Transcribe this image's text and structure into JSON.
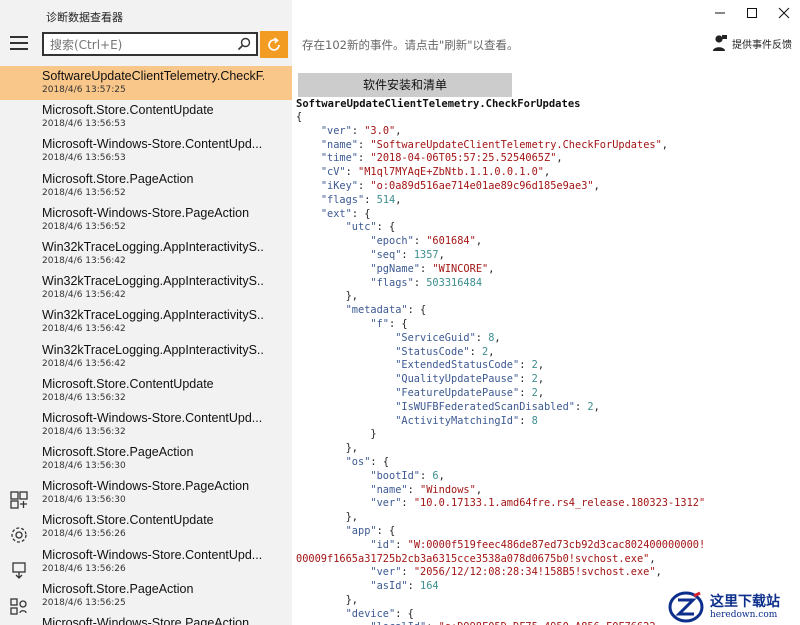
{
  "app": {
    "title": "诊断数据查看器"
  },
  "search": {
    "placeholder": "搜索(Ctrl+E)",
    "value": ""
  },
  "status": {
    "text": "存在102新的事件。请点击\"刷新\"以查看。"
  },
  "feedback": {
    "label": "提供事件反馈"
  },
  "category_tab": {
    "label": "软件安装和清单"
  },
  "selected_event": {
    "name": "SoftwareUpdateClientTelemetry.CheckForUpdates"
  },
  "events": [
    {
      "name": "SoftwareUpdateClientTelemetry.CheckF...",
      "time": "2018/4/6 13:57:25",
      "selected": true
    },
    {
      "name": "Microsoft.Store.ContentUpdate",
      "time": "2018/4/6 13:56:53"
    },
    {
      "name": "Microsoft-Windows-Store.ContentUpd...",
      "time": "2018/4/6 13:56:53"
    },
    {
      "name": "Microsoft.Store.PageAction",
      "time": "2018/4/6 13:56:52"
    },
    {
      "name": "Microsoft-Windows-Store.PageAction",
      "time": "2018/4/6 13:56:52"
    },
    {
      "name": "Win32kTraceLogging.AppInteractivityS...",
      "time": "2018/4/6 13:56:42"
    },
    {
      "name": "Win32kTraceLogging.AppInteractivityS...",
      "time": "2018/4/6 13:56:42"
    },
    {
      "name": "Win32kTraceLogging.AppInteractivityS...",
      "time": "2018/4/6 13:56:42"
    },
    {
      "name": "Win32kTraceLogging.AppInteractivityS...",
      "time": "2018/4/6 13:56:42"
    },
    {
      "name": "Microsoft.Store.ContentUpdate",
      "time": "2018/4/6 13:56:32"
    },
    {
      "name": "Microsoft-Windows-Store.ContentUpd...",
      "time": "2018/4/6 13:56:32"
    },
    {
      "name": "Microsoft.Store.PageAction",
      "time": "2018/4/6 13:56:30"
    },
    {
      "name": "Microsoft-Windows-Store.PageAction",
      "time": "2018/4/6 13:56:30"
    },
    {
      "name": "Microsoft.Store.ContentUpdate",
      "time": "2018/4/6 13:56:26"
    },
    {
      "name": "Microsoft-Windows-Store.ContentUpd...",
      "time": "2018/4/6 13:56:26"
    },
    {
      "name": "Microsoft.Store.PageAction",
      "time": "2018/4/6 13:56:25"
    },
    {
      "name": "Microsoft-Windows-Store.PageAction",
      "time": ""
    }
  ],
  "json_lines": [
    [
      [
        0,
        "p",
        "{"
      ]
    ],
    [
      [
        1,
        "k",
        "\"ver\""
      ],
      [
        0,
        "p",
        ": "
      ],
      [
        0,
        "s",
        "\"3.0\""
      ],
      [
        0,
        "p",
        ","
      ]
    ],
    [
      [
        1,
        "k",
        "\"name\""
      ],
      [
        0,
        "p",
        ": "
      ],
      [
        0,
        "s",
        "\"SoftwareUpdateClientTelemetry.CheckForUpdates\""
      ],
      [
        0,
        "p",
        ","
      ]
    ],
    [
      [
        1,
        "k",
        "\"time\""
      ],
      [
        0,
        "p",
        ": "
      ],
      [
        0,
        "s",
        "\"2018-04-06T05:57:25.5254065Z\""
      ],
      [
        0,
        "p",
        ","
      ]
    ],
    [
      [
        1,
        "k",
        "\"cV\""
      ],
      [
        0,
        "p",
        ": "
      ],
      [
        0,
        "s",
        "\"M1ql7MYAqE+ZbNtb.1.1.0.0.1.0\""
      ],
      [
        0,
        "p",
        ","
      ]
    ],
    [
      [
        1,
        "k",
        "\"iKey\""
      ],
      [
        0,
        "p",
        ": "
      ],
      [
        0,
        "s",
        "\"o:0a89d516ae714e01ae89c96d185e9ae3\""
      ],
      [
        0,
        "p",
        ","
      ]
    ],
    [
      [
        1,
        "k",
        "\"flags\""
      ],
      [
        0,
        "p",
        ": "
      ],
      [
        0,
        "n",
        "514"
      ],
      [
        0,
        "p",
        ","
      ]
    ],
    [
      [
        1,
        "k",
        "\"ext\""
      ],
      [
        0,
        "p",
        ": {"
      ]
    ],
    [
      [
        2,
        "k",
        "\"utc\""
      ],
      [
        0,
        "p",
        ": {"
      ]
    ],
    [
      [
        3,
        "k",
        "\"epoch\""
      ],
      [
        0,
        "p",
        ": "
      ],
      [
        0,
        "s",
        "\"601684\""
      ],
      [
        0,
        "p",
        ","
      ]
    ],
    [
      [
        3,
        "k",
        "\"seq\""
      ],
      [
        0,
        "p",
        ": "
      ],
      [
        0,
        "n",
        "1357"
      ],
      [
        0,
        "p",
        ","
      ]
    ],
    [
      [
        3,
        "k",
        "\"pgName\""
      ],
      [
        0,
        "p",
        ": "
      ],
      [
        0,
        "s",
        "\"WINCORE\""
      ],
      [
        0,
        "p",
        ","
      ]
    ],
    [
      [
        3,
        "k",
        "\"flags\""
      ],
      [
        0,
        "p",
        ": "
      ],
      [
        0,
        "n",
        "503316484"
      ]
    ],
    [
      [
        2,
        "p",
        "},"
      ]
    ],
    [
      [
        2,
        "k",
        "\"metadata\""
      ],
      [
        0,
        "p",
        ": {"
      ]
    ],
    [
      [
        3,
        "k",
        "\"f\""
      ],
      [
        0,
        "p",
        ": {"
      ]
    ],
    [
      [
        4,
        "k",
        "\"ServiceGuid\""
      ],
      [
        0,
        "p",
        ": "
      ],
      [
        0,
        "n",
        "8"
      ],
      [
        0,
        "p",
        ","
      ]
    ],
    [
      [
        4,
        "k",
        "\"StatusCode\""
      ],
      [
        0,
        "p",
        ": "
      ],
      [
        0,
        "n",
        "2"
      ],
      [
        0,
        "p",
        ","
      ]
    ],
    [
      [
        4,
        "k",
        "\"ExtendedStatusCode\""
      ],
      [
        0,
        "p",
        ": "
      ],
      [
        0,
        "n",
        "2"
      ],
      [
        0,
        "p",
        ","
      ]
    ],
    [
      [
        4,
        "k",
        "\"QualityUpdatePause\""
      ],
      [
        0,
        "p",
        ": "
      ],
      [
        0,
        "n",
        "2"
      ],
      [
        0,
        "p",
        ","
      ]
    ],
    [
      [
        4,
        "k",
        "\"FeatureUpdatePause\""
      ],
      [
        0,
        "p",
        ": "
      ],
      [
        0,
        "n",
        "2"
      ],
      [
        0,
        "p",
        ","
      ]
    ],
    [
      [
        4,
        "k",
        "\"IsWUFBFederatedScanDisabled\""
      ],
      [
        0,
        "p",
        ": "
      ],
      [
        0,
        "n",
        "2"
      ],
      [
        0,
        "p",
        ","
      ]
    ],
    [
      [
        4,
        "k",
        "\"ActivityMatchingId\""
      ],
      [
        0,
        "p",
        ": "
      ],
      [
        0,
        "n",
        "8"
      ]
    ],
    [
      [
        3,
        "p",
        "}"
      ]
    ],
    [
      [
        2,
        "p",
        "},"
      ]
    ],
    [
      [
        2,
        "k",
        "\"os\""
      ],
      [
        0,
        "p",
        ": {"
      ]
    ],
    [
      [
        3,
        "k",
        "\"bootId\""
      ],
      [
        0,
        "p",
        ": "
      ],
      [
        0,
        "n",
        "6"
      ],
      [
        0,
        "p",
        ","
      ]
    ],
    [
      [
        3,
        "k",
        "\"name\""
      ],
      [
        0,
        "p",
        ": "
      ],
      [
        0,
        "s",
        "\"Windows\""
      ],
      [
        0,
        "p",
        ","
      ]
    ],
    [
      [
        3,
        "k",
        "\"ver\""
      ],
      [
        0,
        "p",
        ": "
      ],
      [
        0,
        "s",
        "\"10.0.17133.1.amd64fre.rs4_release.180323-1312\""
      ]
    ],
    [
      [
        2,
        "p",
        "},"
      ]
    ],
    [
      [
        2,
        "k",
        "\"app\""
      ],
      [
        0,
        "p",
        ": {"
      ]
    ],
    [
      [
        3,
        "k",
        "\"id\""
      ],
      [
        0,
        "p",
        ": "
      ],
      [
        0,
        "s",
        "\"W:0000f519feec486de87ed73cb92d3cac802400000000!"
      ]
    ],
    [
      [
        0,
        "s",
        "00009f1665a31725b2cb3a6315cce3538a078d0675b0!svchost.exe\""
      ],
      [
        0,
        "p",
        ","
      ]
    ],
    [
      [
        3,
        "k",
        "\"ver\""
      ],
      [
        0,
        "p",
        ": "
      ],
      [
        0,
        "s",
        "\"2056/12/12:08:28:34!158B5!svchost.exe\""
      ],
      [
        0,
        "p",
        ","
      ]
    ],
    [
      [
        3,
        "k",
        "\"asId\""
      ],
      [
        0,
        "p",
        ": "
      ],
      [
        0,
        "n",
        "164"
      ]
    ],
    [
      [
        2,
        "p",
        "},"
      ]
    ],
    [
      [
        2,
        "k",
        "\"device\""
      ],
      [
        0,
        "p",
        ": {"
      ]
    ],
    [
      [
        3,
        "k",
        "\"localId\""
      ],
      [
        0,
        "p",
        ": "
      ],
      [
        0,
        "s",
        "\"s:D998F05D-DF75-4950-A856-F0F76622"
      ]
    ]
  ],
  "watermark": {
    "cn": "这里下载站",
    "url": "heredown.com"
  },
  "colors": {
    "accent": "#f39c24",
    "selected_row": "#f9c78a",
    "pane_bg": "#f2f2f2"
  },
  "icons": {
    "menu": "hamburger-icon",
    "search": "search-icon",
    "refresh": "refresh-icon",
    "feedback": "feedback-person-icon",
    "side": [
      "data-view-icon",
      "settings-gear-icon",
      "export-icon",
      "diagnostics-icon"
    ]
  }
}
